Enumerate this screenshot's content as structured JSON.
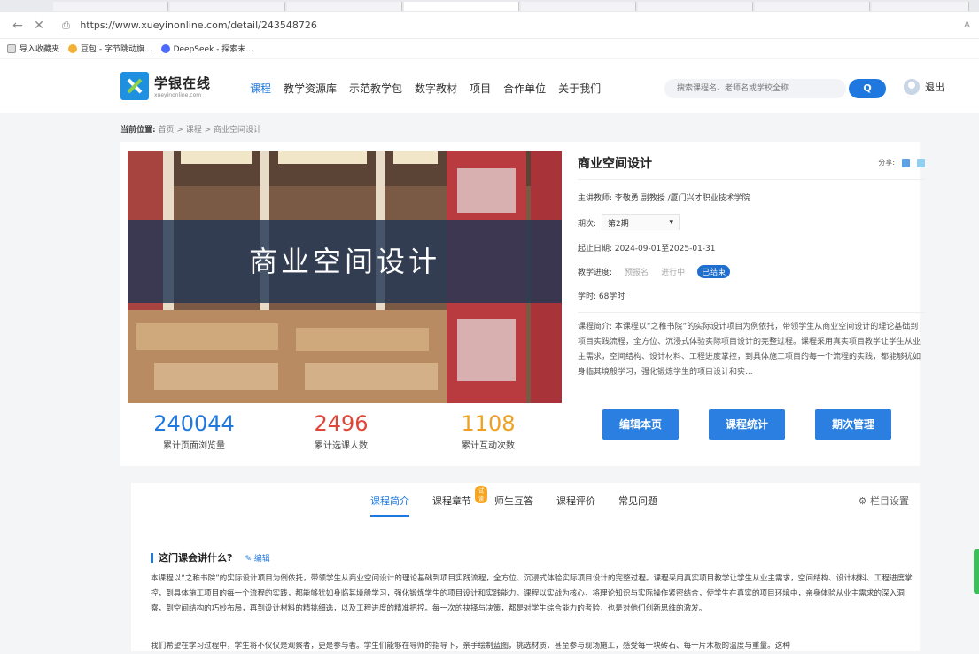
{
  "browser": {
    "url": "https://www.xueyinonline.com/detail/243548726",
    "reader_label": "A",
    "bookmarks": [
      "导入收藏夹",
      "豆包 - 字节跳动旗...",
      "DeepSeek - 探索未..."
    ]
  },
  "header": {
    "logo_title": "学银在线",
    "logo_sub": "xueyinonline.com",
    "nav": [
      "课程",
      "教学资源库",
      "示范教学包",
      "数字教材",
      "项目",
      "合作单位",
      "关于我们"
    ],
    "search_placeholder": "搜索课程名、老师名或学校全称",
    "search_button": "Q",
    "logout": "退出"
  },
  "breadcrumb": {
    "label": "当前位置:",
    "path": "首页 > 课程 > 商业空间设计"
  },
  "course": {
    "cover_title": "商业空间设计",
    "title": "商业空间设计",
    "share_label": "分享:",
    "teacher": "主讲教师: 李敬勇 副教授 /厦门兴才职业技术学院",
    "period_label": "期次:",
    "period_value": "第2期",
    "dates": "起止日期: 2024-09-01至2025-01-31",
    "progress_label": "教学进度:",
    "progress_steps": [
      "预报名",
      "进行中",
      "已结束"
    ],
    "hours": "学时: 68学时",
    "intro": "课程简介: 本课程以“之稚书院”的实际设计项目为例依托，带领学生从商业空间设计的理论基础到项目实践流程，全方位、沉浸式体验实际项目设计的完整过程。课程采用真实项目教学让学生从业主需求，空间结构、设计材料、工程进度掌控，到具体施工项目的每一个流程的实践，都能够犹如身临其境般学习，强化锻炼学生的项目设计和实...",
    "stats": [
      {
        "value": "240044",
        "label": "累计页面浏览量",
        "color": "#1f78e0"
      },
      {
        "value": "2496",
        "label": "累计选课人数",
        "color": "#e0453a"
      },
      {
        "value": "1108",
        "label": "累计互动次数",
        "color": "#f0a020"
      }
    ],
    "actions": [
      "编辑本页",
      "课程统计",
      "期次管理"
    ]
  },
  "content": {
    "tabs": [
      "课程简介",
      "课程章节",
      "师生互答",
      "课程评价",
      "常见问题"
    ],
    "badge": "试读",
    "column_setting": "⚙ 栏目设置",
    "section_title": "这门课会讲什么?",
    "edit_label": "✎ 编辑",
    "paragraph1": "本课程以“之稚书院”的实际设计项目为例依托，带领学生从商业空间设计的理论基础到项目实践流程，全方位、沉浸式体验实际项目设计的完整过程。课程采用真实项目教学让学生从业主需求，空间结构、设计材料、工程进度掌控，到具体施工项目的每一个流程的实践，都能够犹如身临其境般学习，强化锻炼学生的项目设计和实践能力。课程以实战为核心，将理论知识与实际操作紧密结合，使学生在真实的项目环境中，亲身体验从业主需求的深入洞察，到空间结构的巧妙布局，再到设计材料的精挑细选，以及工程进度的精准把控。每一次的抉择与决策，都是对学生综合能力的考验，也是对他们创新思维的激发。",
    "paragraph2": "我们希望在学习过程中，学生将不仅仅是观察者，更是参与者。学生们能够在导师的指导下，亲手绘制蓝图，挑选材质，甚至参与现场施工，感受每一块砖石、每一片木板的温度与重量。这种"
  }
}
